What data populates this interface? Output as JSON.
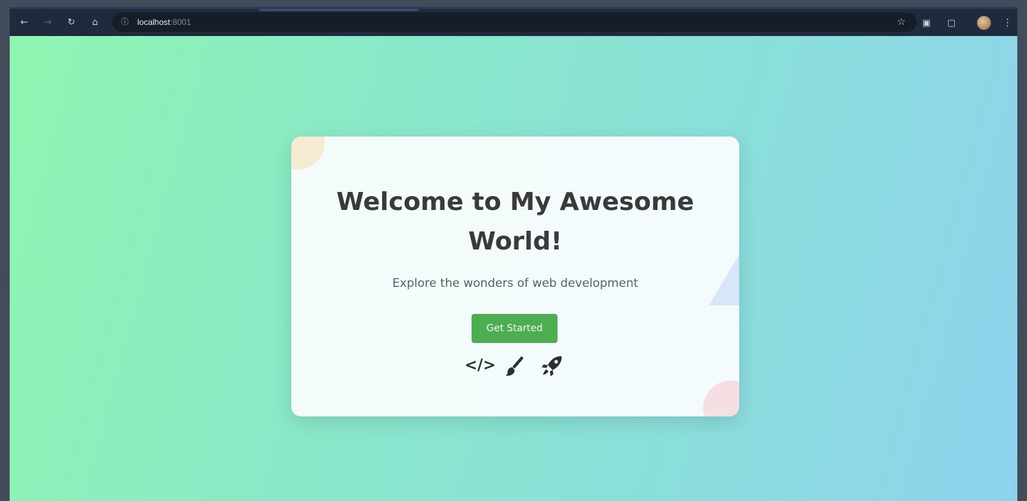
{
  "browser": {
    "url_host": "localhost",
    "url_port": ":8001",
    "icons": [
      "back-icon",
      "forward-icon",
      "reload-icon",
      "home-icon",
      "site-info-icon",
      "bookmark-star-icon",
      "extension-icon",
      "side-panel-icon",
      "profile-avatar",
      "menu-icon"
    ]
  },
  "hero": {
    "title": "Welcome to My Awesome World!",
    "subtitle": "Explore the wonders of web development",
    "cta_label": "Get Started",
    "features": [
      "code-icon",
      "paintbrush-icon",
      "rocket-icon"
    ]
  },
  "colors": {
    "cta": "#4cae50",
    "title": "#3a3a3a",
    "browser_chrome": "#1f2a3c"
  }
}
